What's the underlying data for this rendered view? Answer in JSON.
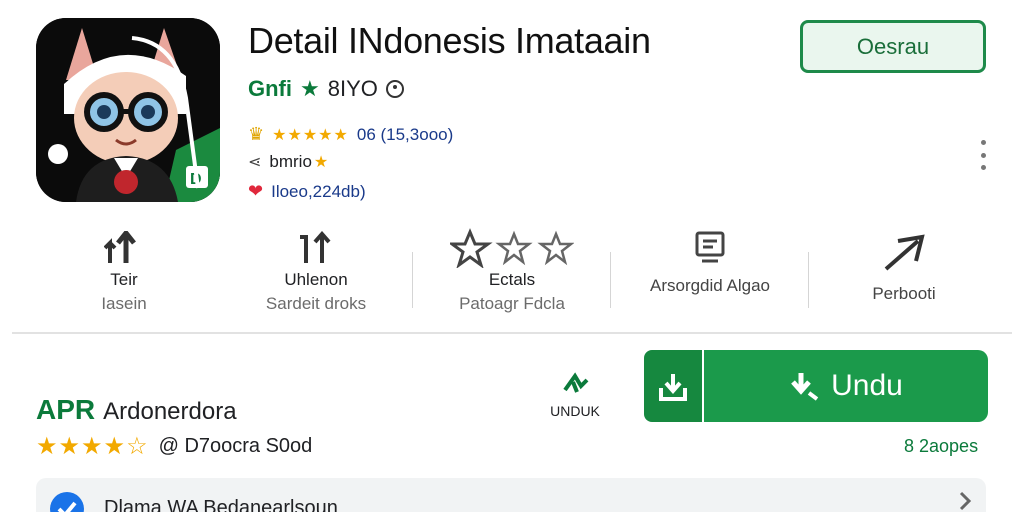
{
  "app": {
    "title": "Detail INdonesis Imataain",
    "developer": "Gnfi",
    "developer_suffix": "8IYO",
    "rating_count": "06 (15,3ooo)",
    "category": "bmrio",
    "downloads_text": "Iloeo,224db)",
    "open_button": "Oesrau",
    "icons": {
      "app_icon": "cartoon-cat-avatar-icon",
      "verified": "star-icon",
      "info": "info-icon",
      "crown": "crown-icon",
      "share": "share-icon",
      "heart": "heart-icon",
      "more": "more-vertical-icon"
    }
  },
  "stats": [
    {
      "line1": "Teir",
      "line2": "Iasein",
      "icon": "arrows-up-icon"
    },
    {
      "line1": "Uhlenon",
      "line2": "Sardeit droks",
      "icon": "upload-arrows-icon"
    },
    {
      "line1": "Ectals",
      "line2": "Patoagr Fdcla",
      "icon": "three-stars-icon"
    },
    {
      "single": "Arsorgdid Algao",
      "icon": "document-icon"
    },
    {
      "single": "Perbooti",
      "icon": "send-arrow-icon"
    }
  ],
  "apk": {
    "badge": "APR",
    "name": "Ardonerdora",
    "rating_label": "@ D7oocra S0od",
    "unduk_label": "UNDUK",
    "download_button": "Undu",
    "pages": "8 2aopes",
    "verify_text": "Dlama WA Bedanearlsoun"
  },
  "colors": {
    "green": "#1b9a4b",
    "dark_green": "#0b7a3b",
    "star": "#f2a900",
    "blue": "#1a73e8",
    "link_blue": "#1a3a8a"
  }
}
